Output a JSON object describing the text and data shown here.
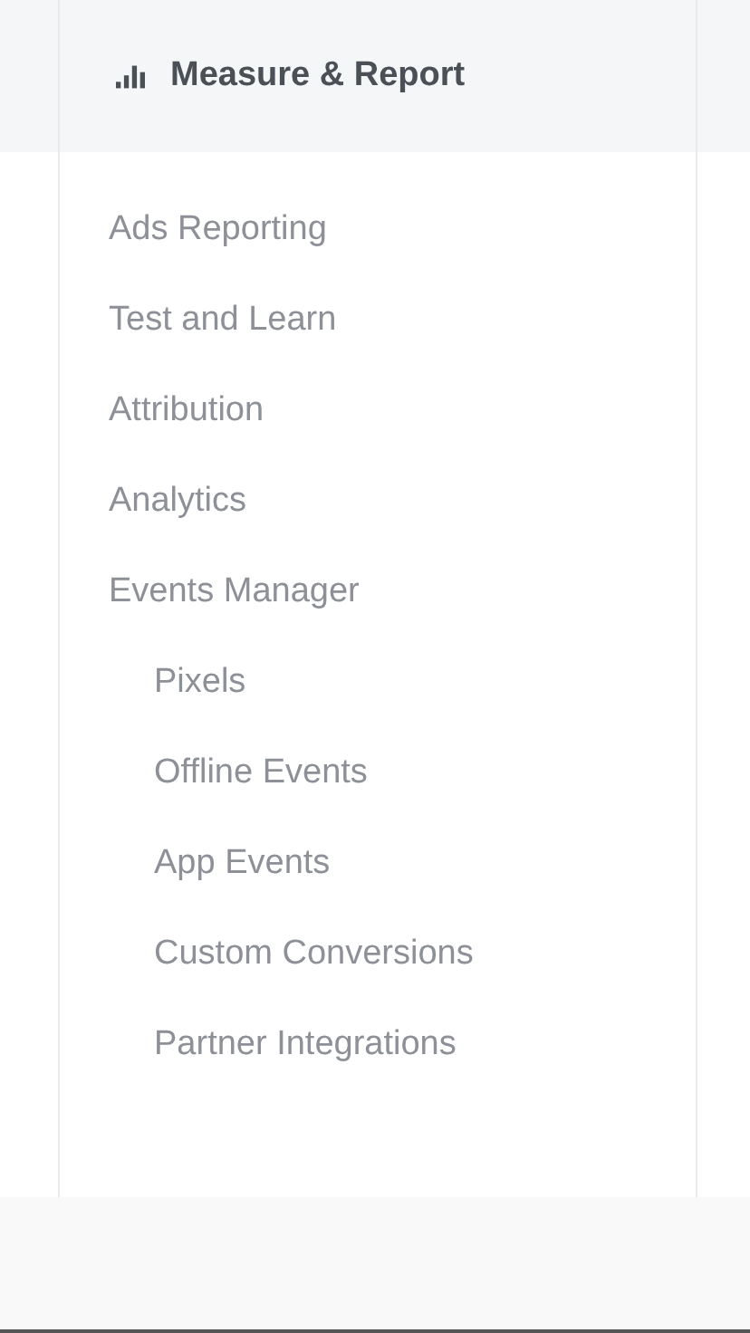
{
  "header": {
    "title": "Measure & Report"
  },
  "menu": [
    {
      "label": "Ads Reporting"
    },
    {
      "label": "Test and Learn"
    },
    {
      "label": "Attribution"
    },
    {
      "label": "Analytics"
    },
    {
      "label": "Events Manager",
      "children": [
        {
          "label": "Pixels"
        },
        {
          "label": "Offline Events"
        },
        {
          "label": "App Events"
        },
        {
          "label": "Custom Conversions"
        },
        {
          "label": "Partner Integrations"
        }
      ]
    }
  ]
}
